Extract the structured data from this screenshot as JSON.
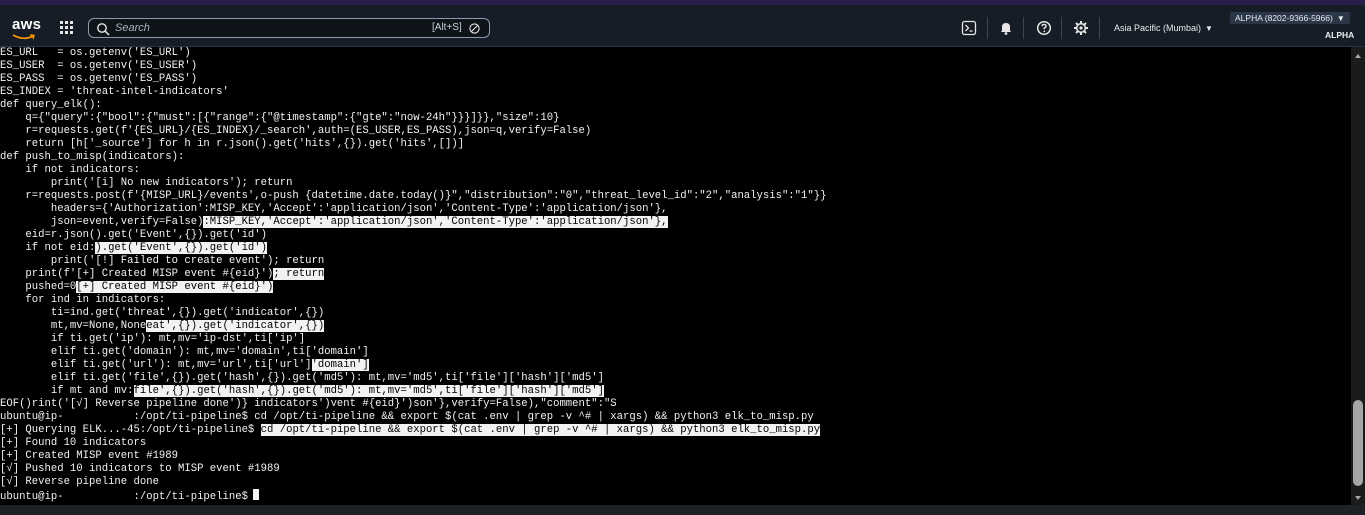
{
  "header": {
    "logo_text": "aws",
    "search_placeholder": "Search",
    "search_shortcut": "[Alt+S]",
    "region": "Asia Pacific (Mumbai)",
    "account": "ALPHA (8202-9366-5966)",
    "account_alias": "ALPHA",
    "icons": [
      "cloudshell-icon",
      "bell-icon",
      "help-icon",
      "gear-icon"
    ]
  },
  "terminal": {
    "lines": [
      "ES_URL   = os.getenv('ES_URL')",
      "ES_USER  = os.getenv('ES_USER')",
      "ES_PASS  = os.getenv('ES_PASS')",
      "ES_INDEX = 'threat-intel-indicators'",
      "def query_elk():",
      "    q={\"query\":{\"bool\":{\"must\":[{\"range\":{\"@timestamp\":{\"gte\":\"now-24h\"}}}]}},\"size\":10}",
      "    r=requests.get(f'{ES_URL}/{ES_INDEX}/_search',auth=(ES_USER,ES_PASS),json=q,verify=False)",
      "    return [h['_source'] for h in r.json().get('hits',{}).get('hits',[])]",
      "def push_to_misp(indicators):",
      "    if not indicators:",
      "        print('[i] No new indicators'); return",
      "    r=requests.post(f'{MISP_URL}/events',o-push {datetime.date.today()}\",\"distribution\":\"0\",\"threat_level_id\":\"2\",\"analysis\":\"1\"}}",
      "        headers={'Authorization':MISP_KEY,'Accept':'application/json','Content-Type':'application/json'},",
      {
        "text": "        json=event,verify=False)",
        "hl": ":MISP_KEY,'Accept':'application/json','Content-Type':'application/json'},"
      },
      "    eid=r.json().get('Event',{}).get('id')",
      {
        "text": "    if not eid:",
        "hl": ").get('Event',{}).get('id')"
      },
      "        print('[!] Failed to create event'); return",
      {
        "text": "    print(f'[+] Created MISP event #{eid}')",
        "hl": "; return"
      },
      {
        "text": "    pushed=0",
        "hl": "[+] Created MISP event #{eid}')"
      },
      "    for ind in indicators:",
      "        ti=ind.get('threat',{}).get('indicator',{})",
      {
        "text": "        mt,mv=None,None",
        "hl": "eat',{}).get('indicator',{})"
      },
      "        if ti.get('ip'): mt,mv='ip-dst',ti['ip']",
      "        elif ti.get('domain'): mt,mv='domain',ti['domain']",
      {
        "text": "        elif ti.get('url'): mt,mv='url',ti['url']",
        "hl": "'domain']"
      },
      "        elif ti.get('file',{}).get('hash',{}).get('md5'): mt,mv='md5',ti['file']['hash']['md5']",
      {
        "text": "        if mt and mv:",
        "hl": "file',{}).get('hash',{}).get('md5'): mt,mv='md5',ti['file']['hash']['md5']"
      },
      "EOF()rint('[√] Reverse pipeline done')} indicators')vent #{eid}')son'},verify=False),\"comment\":\"S",
      "ubuntu@ip-           :/opt/ti-pipeline$ cd /opt/ti-pipeline && export $(cat .env | grep -v ^# | xargs) && python3 elk_to_misp.py",
      {
        "text": "[+] Querying ELK...-45:/opt/ti-pipeline$ ",
        "hl": "cd /opt/ti-pipeline && export $(cat .env | grep -v ^# | xargs) && python3 elk_to_misp.py"
      },
      "[+] Found 10 indicators",
      "[+] Created MISP event #1989",
      "[√] Pushed 10 indicators to MISP event #1989",
      "[√] Reverse pipeline done",
      {
        "text": "ubuntu@ip-           :/opt/ti-pipeline$",
        "cursor": true
      }
    ]
  }
}
